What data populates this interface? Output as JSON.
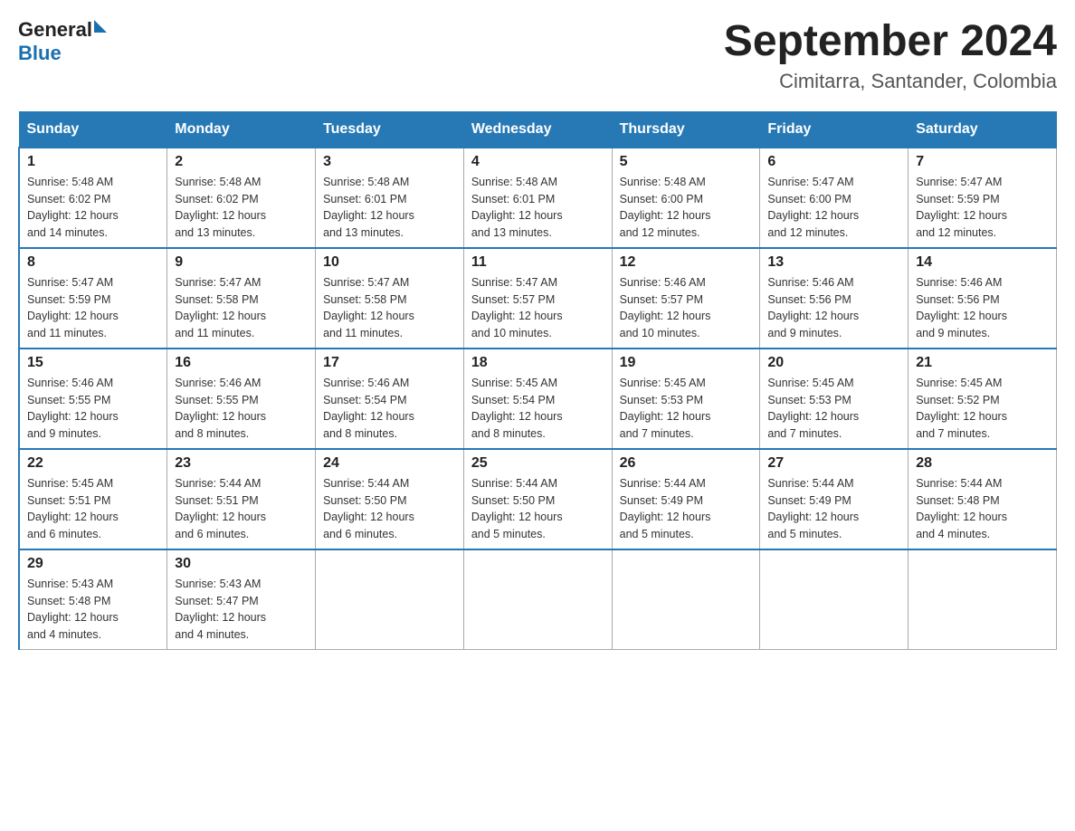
{
  "logo": {
    "general": "General",
    "blue": "Blue"
  },
  "title": "September 2024",
  "subtitle": "Cimitarra, Santander, Colombia",
  "days_of_week": [
    "Sunday",
    "Monday",
    "Tuesday",
    "Wednesday",
    "Thursday",
    "Friday",
    "Saturday"
  ],
  "weeks": [
    [
      {
        "day": "1",
        "sunrise": "5:48 AM",
        "sunset": "6:02 PM",
        "daylight": "12 hours and 14 minutes."
      },
      {
        "day": "2",
        "sunrise": "5:48 AM",
        "sunset": "6:02 PM",
        "daylight": "12 hours and 13 minutes."
      },
      {
        "day": "3",
        "sunrise": "5:48 AM",
        "sunset": "6:01 PM",
        "daylight": "12 hours and 13 minutes."
      },
      {
        "day": "4",
        "sunrise": "5:48 AM",
        "sunset": "6:01 PM",
        "daylight": "12 hours and 13 minutes."
      },
      {
        "day": "5",
        "sunrise": "5:48 AM",
        "sunset": "6:00 PM",
        "daylight": "12 hours and 12 minutes."
      },
      {
        "day": "6",
        "sunrise": "5:47 AM",
        "sunset": "6:00 PM",
        "daylight": "12 hours and 12 minutes."
      },
      {
        "day": "7",
        "sunrise": "5:47 AM",
        "sunset": "5:59 PM",
        "daylight": "12 hours and 12 minutes."
      }
    ],
    [
      {
        "day": "8",
        "sunrise": "5:47 AM",
        "sunset": "5:59 PM",
        "daylight": "12 hours and 11 minutes."
      },
      {
        "day": "9",
        "sunrise": "5:47 AM",
        "sunset": "5:58 PM",
        "daylight": "12 hours and 11 minutes."
      },
      {
        "day": "10",
        "sunrise": "5:47 AM",
        "sunset": "5:58 PM",
        "daylight": "12 hours and 11 minutes."
      },
      {
        "day": "11",
        "sunrise": "5:47 AM",
        "sunset": "5:57 PM",
        "daylight": "12 hours and 10 minutes."
      },
      {
        "day": "12",
        "sunrise": "5:46 AM",
        "sunset": "5:57 PM",
        "daylight": "12 hours and 10 minutes."
      },
      {
        "day": "13",
        "sunrise": "5:46 AM",
        "sunset": "5:56 PM",
        "daylight": "12 hours and 9 minutes."
      },
      {
        "day": "14",
        "sunrise": "5:46 AM",
        "sunset": "5:56 PM",
        "daylight": "12 hours and 9 minutes."
      }
    ],
    [
      {
        "day": "15",
        "sunrise": "5:46 AM",
        "sunset": "5:55 PM",
        "daylight": "12 hours and 9 minutes."
      },
      {
        "day": "16",
        "sunrise": "5:46 AM",
        "sunset": "5:55 PM",
        "daylight": "12 hours and 8 minutes."
      },
      {
        "day": "17",
        "sunrise": "5:46 AM",
        "sunset": "5:54 PM",
        "daylight": "12 hours and 8 minutes."
      },
      {
        "day": "18",
        "sunrise": "5:45 AM",
        "sunset": "5:54 PM",
        "daylight": "12 hours and 8 minutes."
      },
      {
        "day": "19",
        "sunrise": "5:45 AM",
        "sunset": "5:53 PM",
        "daylight": "12 hours and 7 minutes."
      },
      {
        "day": "20",
        "sunrise": "5:45 AM",
        "sunset": "5:53 PM",
        "daylight": "12 hours and 7 minutes."
      },
      {
        "day": "21",
        "sunrise": "5:45 AM",
        "sunset": "5:52 PM",
        "daylight": "12 hours and 7 minutes."
      }
    ],
    [
      {
        "day": "22",
        "sunrise": "5:45 AM",
        "sunset": "5:51 PM",
        "daylight": "12 hours and 6 minutes."
      },
      {
        "day": "23",
        "sunrise": "5:44 AM",
        "sunset": "5:51 PM",
        "daylight": "12 hours and 6 minutes."
      },
      {
        "day": "24",
        "sunrise": "5:44 AM",
        "sunset": "5:50 PM",
        "daylight": "12 hours and 6 minutes."
      },
      {
        "day": "25",
        "sunrise": "5:44 AM",
        "sunset": "5:50 PM",
        "daylight": "12 hours and 5 minutes."
      },
      {
        "day": "26",
        "sunrise": "5:44 AM",
        "sunset": "5:49 PM",
        "daylight": "12 hours and 5 minutes."
      },
      {
        "day": "27",
        "sunrise": "5:44 AM",
        "sunset": "5:49 PM",
        "daylight": "12 hours and 5 minutes."
      },
      {
        "day": "28",
        "sunrise": "5:44 AM",
        "sunset": "5:48 PM",
        "daylight": "12 hours and 4 minutes."
      }
    ],
    [
      {
        "day": "29",
        "sunrise": "5:43 AM",
        "sunset": "5:48 PM",
        "daylight": "12 hours and 4 minutes."
      },
      {
        "day": "30",
        "sunrise": "5:43 AM",
        "sunset": "5:47 PM",
        "daylight": "12 hours and 4 minutes."
      },
      null,
      null,
      null,
      null,
      null
    ]
  ]
}
